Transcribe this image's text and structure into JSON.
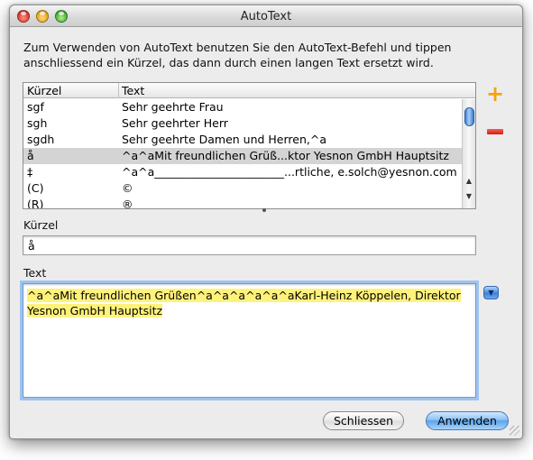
{
  "window": {
    "title": "AutoText"
  },
  "description": "Zum Verwenden von AutoText benutzen Sie den AutoText-Befehl und tippen anschliessend ein Kürzel, das dann durch einen langen Text ersetzt wird.",
  "table": {
    "headers": {
      "shortcut": "Kürzel",
      "text": "Text"
    },
    "rows": [
      {
        "shortcut": "sgf",
        "text": "Sehr geehrte Frau"
      },
      {
        "shortcut": "sgh",
        "text": "Sehr geehrter Herr"
      },
      {
        "shortcut": "sgdh",
        "text": "Sehr geehrte Damen und Herren,^a"
      },
      {
        "shortcut": "å",
        "text": "^a^aMit freundlichen Grüß...ktor Yesnon GmbH Hauptsitz",
        "selected": true
      },
      {
        "shortcut": "‡",
        "text": "^a^a_______________________...rtliche, e.solch@yesnon.com"
      },
      {
        "shortcut": "(C)",
        "text": "©"
      },
      {
        "shortcut": "(R)",
        "text": "®"
      }
    ],
    "add_glyph": "+"
  },
  "shortcut_field": {
    "label": "Kürzel",
    "value": "å"
  },
  "text_field": {
    "label": "Text",
    "line1": "^a^aMit freundlichen Grüßen^a^a^a^a^a^aKarl-Heinz Köppelen, Direktor",
    "line2": "Yesnon GmbH Hauptsitz"
  },
  "buttons": {
    "cancel": "Schliessen",
    "apply": "Anwenden"
  },
  "icons": {
    "add": "plus-icon",
    "remove": "minus-icon",
    "popup": "chevron-down-icon"
  },
  "colors": {
    "add": "#f5a10f",
    "remove": "#e0251b",
    "highlight": "#fff27a",
    "selection": "#d4d4d4"
  }
}
